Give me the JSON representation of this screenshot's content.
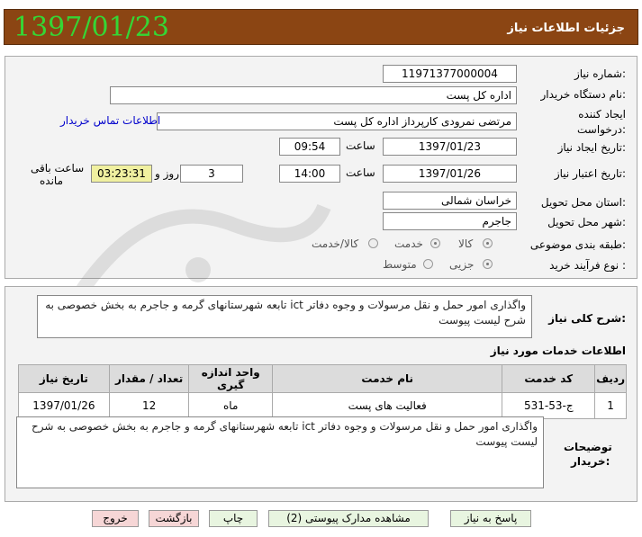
{
  "header": {
    "title": "جزئیات اطلاعات نیاز",
    "date": "1397/01/23"
  },
  "form": {
    "need_number_label": "شماره نیاز:",
    "need_number": "11971377000004",
    "buyer_org_label": "نام دستگاه خریدار:",
    "buyer_org": "اداره کل پست",
    "creator_label_1": "ایجاد کننده",
    "creator_label_2": "درخواست:",
    "creator": "مرتضی  نمرودی کارپرداز اداره کل پست",
    "contact_link": "اطلاعات تماس خریدار",
    "create_date_label": "تاریخ ایجاد نیاز:",
    "create_date": "1397/01/23",
    "time_label": "ساعت",
    "create_time": "09:54",
    "validity_label": "تاریخ اعتبار نیاز:",
    "validity_date": "1397/01/26",
    "validity_time": "14:00",
    "days_label": "روز و",
    "days": "3",
    "remaining_time": "03:23:31",
    "remaining_label_1": "ساعت باقی",
    "remaining_label_2": "مانده",
    "province_label": "استان محل تحویل:",
    "province": "خراسان شمالی",
    "city_label": "شهر محل تحویل:",
    "city": "جاجرم",
    "category_label": "طبقه بندی موضوعی:",
    "category_options": [
      "کالا",
      "خدمت",
      "کالا/خدمت"
    ],
    "purchase_type_label": "نوع فرآیند خرید :",
    "purchase_type_options": [
      "جزیی",
      "متوسط"
    ]
  },
  "summary": {
    "label": "شرح کلی نیاز:",
    "text": "واگذاری امور حمل و نقل مرسولات و وجوه دفاتر ict تابعه شهرستانهای گرمه و جاجرم به بخش خصوصی به شرح لیست پیوست"
  },
  "services": {
    "title": "اطلاعات خدمات مورد نیاز",
    "columns": [
      "ردیف",
      "کد خدمت",
      "نام خدمت",
      "واحد اندازه گیری",
      "تعداد / مقدار",
      "تاریخ نیاز"
    ],
    "rows": [
      [
        "1",
        "ج-53-531",
        "فعالیت های پست",
        "ماه",
        "12",
        "1397/01/26"
      ]
    ]
  },
  "buyer_notes": {
    "label_1": "توضیحات",
    "label_2": "خریدار:",
    "text": "واگذاری امور حمل و نقل مرسولات و وجوه دفاتر ict تابعه شهرستانهای گرمه و جاجرم به بخش خصوصی به شرح لیست پیوست"
  },
  "buttons": {
    "respond": "پاسخ به نیاز",
    "attachments": "مشاهده مدارک پیوستی (2)",
    "print": "چاپ",
    "back": "بازگشت",
    "exit": "خروج"
  },
  "colors": {
    "header_bg": "#8b4513",
    "date_green": "#35d635",
    "button_green": "#e8f5e0",
    "button_pink": "#f6d6d6"
  }
}
